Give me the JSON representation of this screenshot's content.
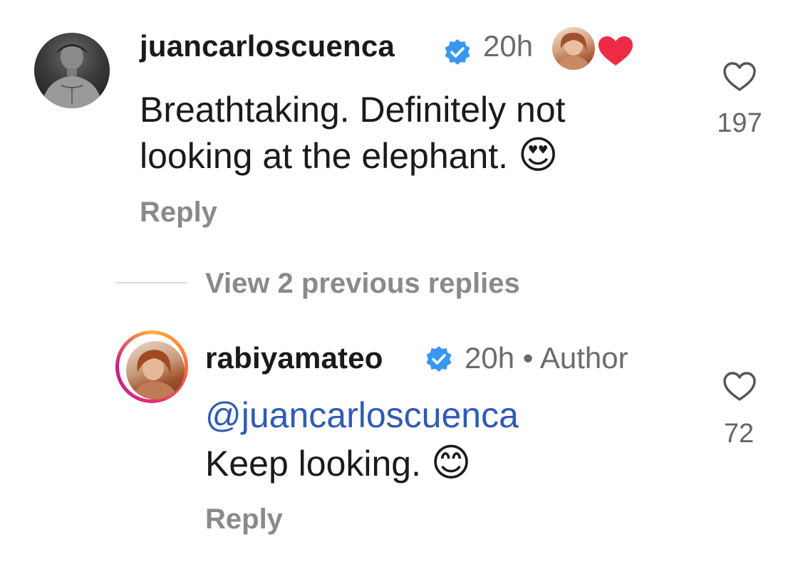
{
  "comment": {
    "username": "juancarloscuenca",
    "time": "20h",
    "text_line1": "Breathtaking. Definitely not",
    "text_line2": "looking at the elephant.",
    "emoji": "😍",
    "reply_label": "Reply",
    "like_count": "197",
    "verified_icon": "verified-badge-icon",
    "liked_by_author_icon": "heart-icon",
    "colors": {
      "verified": "#3897f0",
      "heart": "#ed2b45"
    }
  },
  "view_replies_label": "View 2 previous replies",
  "reply": {
    "username": "rabiyamateo",
    "time": "20h",
    "separator": "•",
    "author_label": "Author",
    "mention": "@juancarloscuenca",
    "text": "Keep looking.",
    "emoji": "😊",
    "reply_label": "Reply",
    "like_count": "72"
  }
}
